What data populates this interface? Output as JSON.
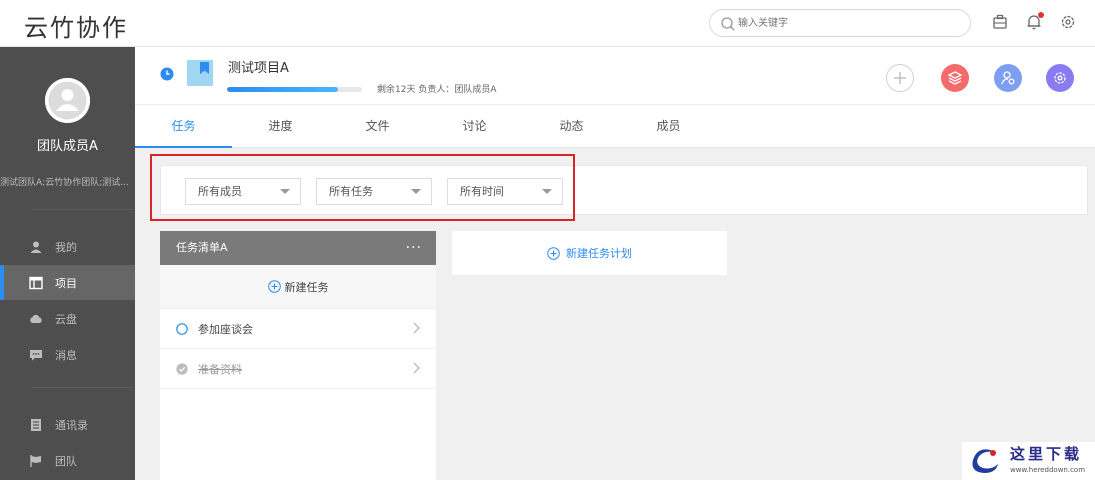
{
  "app": {
    "brand": "云竹协作"
  },
  "search": {
    "placeholder": "输入关键字"
  },
  "colors": {
    "accent": "#2d8cf0",
    "sidebar": "#4e4e4e",
    "highlight": "#d9252a",
    "btn_red": "#f36b6b",
    "btn_blue": "#7e9ef2",
    "btn_purple": "#8a7cf0"
  },
  "user": {
    "name": "团队成员A",
    "teams": "测试团队A;云竹协作团队;测试..."
  },
  "sidebar": {
    "items": [
      {
        "label": "我的",
        "icon": "user-icon"
      },
      {
        "label": "项目",
        "icon": "project-icon"
      },
      {
        "label": "云盘",
        "icon": "cloud-icon"
      },
      {
        "label": "消息",
        "icon": "message-icon"
      },
      {
        "label": "通讯录",
        "icon": "contacts-icon"
      },
      {
        "label": "团队",
        "icon": "flag-icon"
      }
    ]
  },
  "project": {
    "title": "测试项目A",
    "meta": "剩余12天 负责人：团队成员A",
    "progress": 0.82
  },
  "tabs": [
    {
      "label": "任务"
    },
    {
      "label": "进度"
    },
    {
      "label": "文件"
    },
    {
      "label": "讨论"
    },
    {
      "label": "动态"
    },
    {
      "label": "成员"
    }
  ],
  "filters": {
    "members": "所有成员",
    "tasks": "所有任务",
    "time": "所有时间"
  },
  "task_list": {
    "title": "任务清单A",
    "menu": "···",
    "new_task_label": "新建任务",
    "tasks": [
      {
        "label": "参加座谈会",
        "done": false
      },
      {
        "label": "准备资料",
        "done": true
      }
    ]
  },
  "new_plan_label": "新建任务计划",
  "watermark": {
    "text": "这里下载",
    "url": "www.hereddown.com"
  }
}
